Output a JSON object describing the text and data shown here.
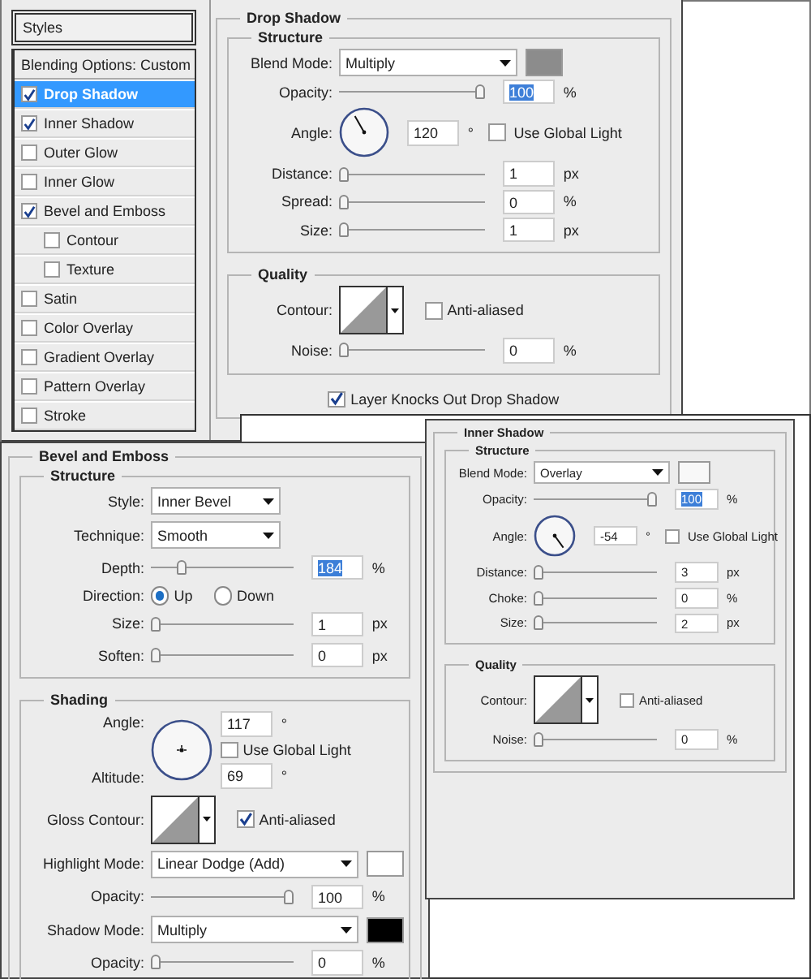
{
  "styles_panel": {
    "header": "Styles",
    "blending_options": "Blending Options: Custom",
    "items": [
      {
        "label": "Drop Shadow",
        "checked": true,
        "selected": true
      },
      {
        "label": "Inner Shadow",
        "checked": true,
        "selected": false
      },
      {
        "label": "Outer Glow",
        "checked": false,
        "selected": false
      },
      {
        "label": "Inner Glow",
        "checked": false,
        "selected": false
      },
      {
        "label": "Bevel and Emboss",
        "checked": true,
        "selected": false,
        "children": [
          {
            "label": "Contour",
            "checked": false,
            "selected": false
          },
          {
            "label": "Texture",
            "checked": false,
            "selected": false
          }
        ]
      },
      {
        "label": "Satin",
        "checked": false,
        "selected": false
      },
      {
        "label": "Color Overlay",
        "checked": false,
        "selected": false
      },
      {
        "label": "Gradient Overlay",
        "checked": false,
        "selected": false
      },
      {
        "label": "Pattern Overlay",
        "checked": false,
        "selected": false
      },
      {
        "label": "Stroke",
        "checked": false,
        "selected": false
      }
    ]
  },
  "drop_shadow": {
    "title": "Drop Shadow",
    "groups": [
      {
        "title": "Structure",
        "rows": [
          {
            "kind": "select",
            "label": "Blend Mode:",
            "value": "Multiply",
            "color": "#8c8c8c"
          },
          {
            "kind": "slider",
            "label": "Opacity:",
            "level": 1,
            "value": "100",
            "unit": "%",
            "text_selected": true
          },
          {
            "kind": "angle",
            "label": "Angle:",
            "value": "120",
            "unit": "°",
            "check_label": "Use Global Light",
            "checked": false
          },
          {
            "kind": "slider",
            "label": "Distance:",
            "level": 0,
            "value": "1",
            "unit": "px",
            "text_selected": false
          },
          {
            "kind": "slider",
            "label": "Spread:",
            "level": 0,
            "value": "0",
            "unit": "%",
            "text_selected": false
          },
          {
            "kind": "slider",
            "label": "Size:",
            "level": 0,
            "value": "1",
            "unit": "px",
            "text_selected": false
          }
        ]
      },
      {
        "title": "Quality",
        "rows": [
          {
            "kind": "contour",
            "label": "Contour:",
            "check_label": "Anti-aliased",
            "checked": false
          },
          {
            "kind": "slider",
            "label": "Noise:",
            "level": 0,
            "value": "0",
            "unit": "%",
            "text_selected": false
          }
        ]
      }
    ],
    "footer": {
      "label": "Layer Knocks Out Drop Shadow",
      "checked": true
    }
  },
  "bevel_emboss": {
    "title": "Bevel and Emboss",
    "groups": [
      {
        "title": "Structure",
        "rows": [
          {
            "kind": "select",
            "label": "Style:",
            "value": "Inner Bevel"
          },
          {
            "kind": "select",
            "label": "Technique:",
            "value": "Smooth"
          },
          {
            "kind": "slider",
            "label": "Depth:",
            "level": 0.2,
            "value": "184",
            "unit": "%",
            "text_selected": true
          },
          {
            "kind": "radio",
            "label": "Direction:",
            "options": [
              {
                "label": "Up",
                "selected": true
              },
              {
                "label": "Down",
                "selected": false
              }
            ]
          },
          {
            "kind": "slider",
            "label": "Size:",
            "level": 0,
            "value": "1",
            "unit": "px",
            "text_selected": false
          },
          {
            "kind": "slider",
            "label": "Soften:",
            "level": 0,
            "value": "0",
            "unit": "px",
            "text_selected": false
          }
        ]
      },
      {
        "title": "Shading",
        "rows": [
          {
            "kind": "shading",
            "label": "Angle:",
            "value": "117",
            "unit": "°",
            "check_label": "Use Global Light",
            "checked": false,
            "altitude_label": "Altitude:",
            "altitude_value": "69",
            "altitude_unit": "°"
          },
          {
            "kind": "contour",
            "label": "Gloss Contour:",
            "check_label": "Anti-aliased",
            "checked": true
          },
          {
            "kind": "select",
            "label": "Highlight Mode:",
            "value": "Linear Dodge (Add)",
            "color": "#ffffff"
          },
          {
            "kind": "slider",
            "label": "Opacity:",
            "level": 1,
            "value": "100",
            "unit": "%",
            "text_selected": false
          },
          {
            "kind": "select",
            "label": "Shadow Mode:",
            "value": "Multiply",
            "color": "#000000"
          },
          {
            "kind": "slider",
            "label": "Opacity:",
            "level": 0,
            "value": "0",
            "unit": "%",
            "text_selected": false
          }
        ]
      }
    ]
  },
  "inner_shadow": {
    "title": "Inner Shadow",
    "groups": [
      {
        "title": "Structure",
        "rows": [
          {
            "kind": "select",
            "label": "Blend Mode:",
            "value": "Overlay",
            "color": "#f8f8f8"
          },
          {
            "kind": "slider",
            "label": "Opacity:",
            "level": 1,
            "value": "100",
            "unit": "%",
            "text_selected": true
          },
          {
            "kind": "angle",
            "label": "Angle:",
            "value": "-54",
            "unit": "°",
            "check_label": "Use Global Light",
            "checked": false
          },
          {
            "kind": "slider",
            "label": "Distance:",
            "level": 0,
            "value": "3",
            "unit": "px",
            "text_selected": false
          },
          {
            "kind": "slider",
            "label": "Choke:",
            "level": 0,
            "value": "0",
            "unit": "%",
            "text_selected": false
          },
          {
            "kind": "slider",
            "label": "Size:",
            "level": 0,
            "value": "2",
            "unit": "px",
            "text_selected": false
          }
        ]
      },
      {
        "title": "Quality",
        "rows": [
          {
            "kind": "contour",
            "label": "Contour:",
            "check_label": "Anti-aliased",
            "checked": false
          },
          {
            "kind": "slider",
            "label": "Noise:",
            "level": 0,
            "value": "0",
            "unit": "%",
            "text_selected": false
          }
        ]
      }
    ]
  }
}
